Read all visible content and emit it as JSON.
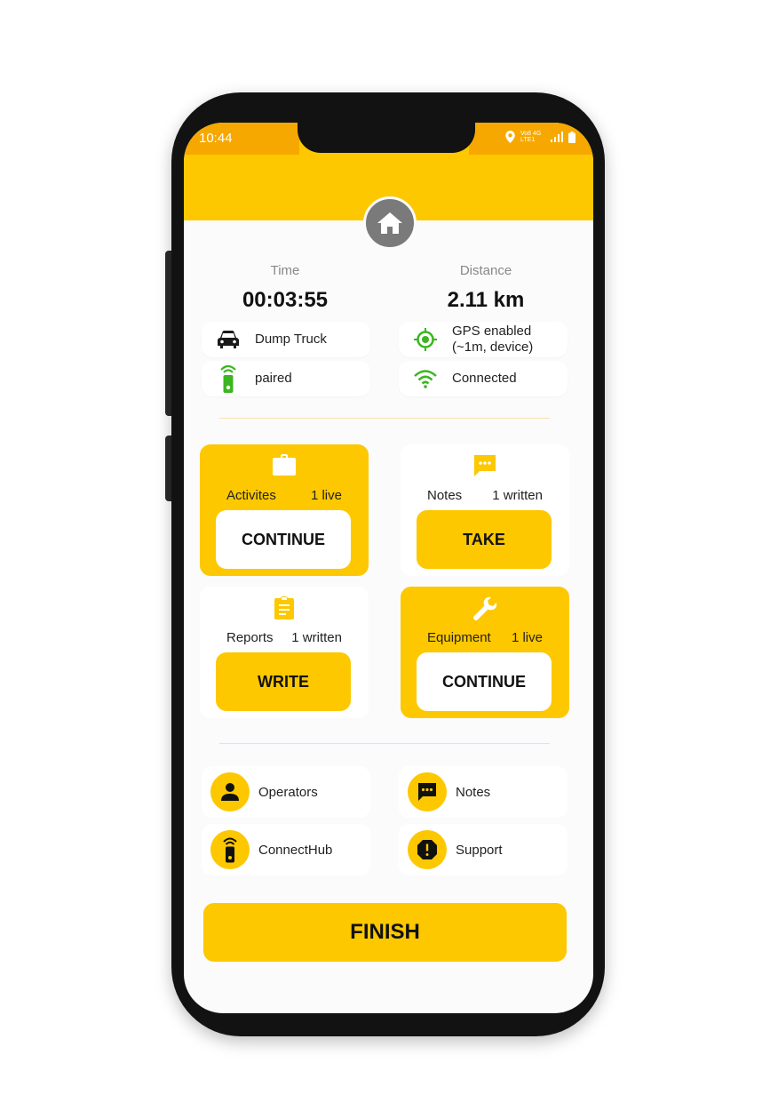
{
  "status_bar": {
    "time": "10:44",
    "network": "Vo8 4G LTE1"
  },
  "stats": {
    "time_label": "Time",
    "time_value": "00:03:55",
    "distance_label": "Distance",
    "distance_value": "2.11 km"
  },
  "info": {
    "vehicle": "Dump Truck",
    "gps_line1": "GPS enabled",
    "gps_line2": "(~1m, device)",
    "hub_status": "paired",
    "wifi_status": "Connected"
  },
  "tiles": [
    {
      "label": "Activites",
      "count": "1 live",
      "button": "CONTINUE",
      "icon": "briefcase-icon"
    },
    {
      "label": "Notes",
      "count": "1 written",
      "button": "TAKE",
      "icon": "chat-icon"
    },
    {
      "label": "Reports",
      "count": "1 written",
      "button": "WRITE",
      "icon": "clipboard-icon"
    },
    {
      "label": "Equipment",
      "count": "1 live",
      "button": "CONTINUE",
      "icon": "wrench-icon"
    }
  ],
  "links": [
    {
      "label": "Operators",
      "icon": "person-icon"
    },
    {
      "label": "Notes",
      "icon": "chat-icon"
    },
    {
      "label": "ConnectHub",
      "icon": "hub-device-icon"
    },
    {
      "label": "Support",
      "icon": "alert-icon"
    }
  ],
  "finish_label": "FINISH",
  "colors": {
    "accent": "#fdc800",
    "status_bar": "#f6a800",
    "gps_green": "#3cb521",
    "home_gray": "#7a7a7a"
  }
}
